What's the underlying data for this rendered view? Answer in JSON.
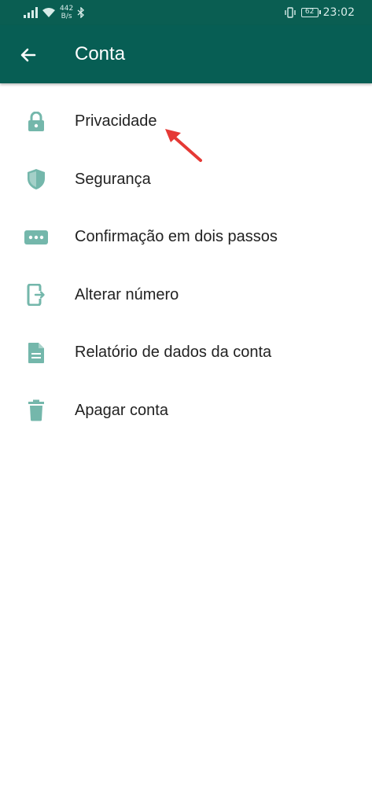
{
  "status_bar": {
    "speed_value": "442",
    "speed_unit": "B/s",
    "battery": "62",
    "time": "23:02"
  },
  "app_bar": {
    "title": "Conta",
    "back_icon": "arrow-left-icon"
  },
  "menu": {
    "items": [
      {
        "label": "Privacidade",
        "icon": "lock-icon"
      },
      {
        "label": "Segurança",
        "icon": "shield-icon"
      },
      {
        "label": "Confirmação em dois passos",
        "icon": "dots-icon"
      },
      {
        "label": "Alterar número",
        "icon": "phone-change-icon"
      },
      {
        "label": "Relatório de dados da conta",
        "icon": "document-icon"
      },
      {
        "label": "Apagar conta",
        "icon": "trash-icon"
      }
    ]
  },
  "colors": {
    "header": "#075e54",
    "status_bar": "#0a5e52",
    "icon": "#74b7ab",
    "annotation": "#e53935"
  }
}
